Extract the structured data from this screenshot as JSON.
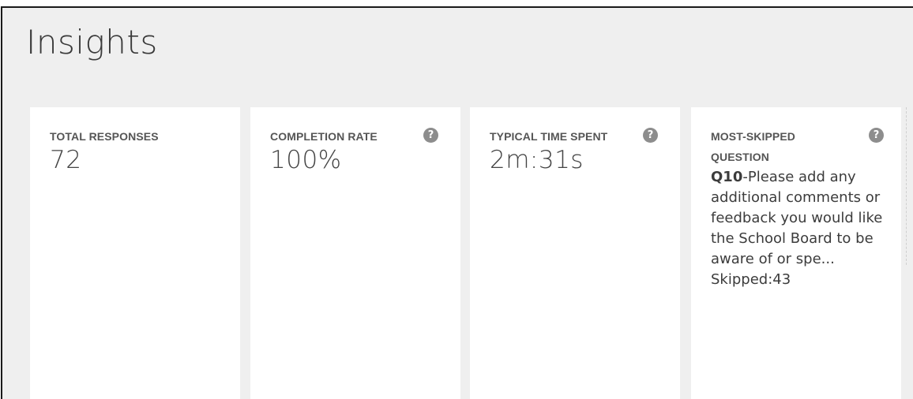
{
  "page": {
    "title": "Insights"
  },
  "cards": [
    {
      "label": "TOTAL RESPONSES",
      "value": "72"
    },
    {
      "label": "COMPLETION RATE",
      "value": "100%",
      "help_icon": "question-icon",
      "help_glyph": "?"
    },
    {
      "label": "TYPICAL TIME SPENT",
      "value": "2m:31s",
      "help_icon": "question-icon",
      "help_glyph": "?"
    },
    {
      "label": "MOST-SKIPPED QUESTION",
      "help_icon": "question-icon",
      "help_glyph": "?",
      "question_id": "Q10",
      "question_text": "-Please add any additional comments or feedback you would like the School Board to be aware of or spe...",
      "skipped": "Skipped:43"
    }
  ],
  "colors": {
    "background": "#efefef",
    "card": "#ffffff",
    "help_icon": "#8d8d8d",
    "text": "#3c3c3c"
  }
}
